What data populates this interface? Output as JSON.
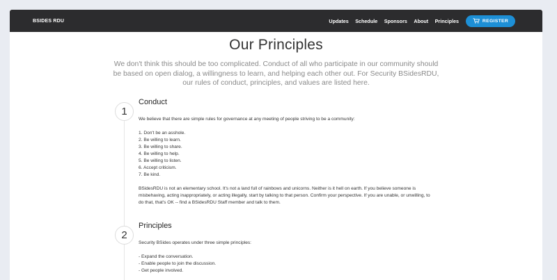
{
  "nav": {
    "brand": "BSIDES RDU",
    "links": [
      "Updates",
      "Schedule",
      "Sponsors",
      "About",
      "Principles"
    ],
    "register": "REGISTER",
    "register_icon": "cart-icon"
  },
  "page": {
    "title": "Our Principles",
    "intro": "We don't think this should be too complicated. Conduct of all who participate in our community should be based on open dialog, a willingness to learn, and helping each other out. For Security BSidesRDU, our rules of conduct, principles, and values are listed here."
  },
  "sections": [
    {
      "number": "1",
      "title": "Conduct",
      "intro": "We believe that there are simple rules for governance at any meeting of people striving to be a community:",
      "items": [
        "1. Don't be an asshole.",
        "2. Be willing to learn.",
        "3. Be willing to share.",
        "4. Be willing to help.",
        "5. Be willing to listen.",
        "6. Accept criticism.",
        "7. Be kind."
      ],
      "closing": "BSidesRDU is not an elementary school. It's not a land full of rainbows and unicorns. Neither is it hell on earth. If you believe someone is misbehaving, acting inappropriately, or acting illegally, start by talking to that person. Confirm your perspective. If you are unable, or unwilling, to do that, that's OK -- find a BSidesRDU Staff member and talk to them."
    },
    {
      "number": "2",
      "title": "Principles",
      "intro": "Security BSides operates under three simple principles:",
      "items": [
        "- Expand the conversation.",
        "- Enable people to join the discussion.",
        "- Get people involved."
      ]
    }
  ]
}
